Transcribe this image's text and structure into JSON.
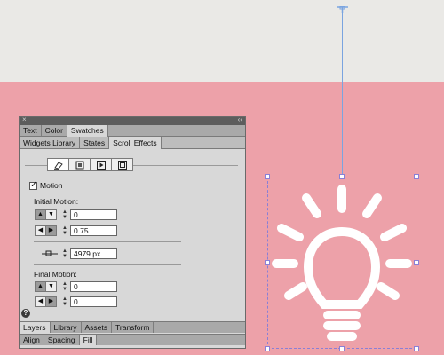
{
  "panel": {
    "close_glyph": "×",
    "collapse_glyph": "‹‹",
    "top_tabs": [
      "Text",
      "Color",
      "Swatches"
    ],
    "sub_tabs": [
      "Widgets Library",
      "States",
      "Scroll Effects"
    ],
    "mode_icons": [
      "eraser-icon",
      "layout-icon",
      "play-icon",
      "slideshow-icon"
    ],
    "motion_label": "Motion",
    "motion_checked": true,
    "initial_motion_label": "Initial Motion:",
    "initial_vertical_value": "0",
    "initial_horizontal_value": "0.75",
    "key_position_value": "4979 px",
    "final_motion_label": "Final Motion:",
    "final_vertical_value": "0",
    "final_horizontal_value": "0",
    "help_glyph": "?",
    "bottom_tabs_row1": [
      "Layers",
      "Library",
      "Assets",
      "Transform"
    ],
    "bottom_tabs_row2": [
      "Align",
      "Spacing",
      "Fill"
    ]
  },
  "colors": {
    "canvas_top": "#eae9e6",
    "canvas_pink": "#eda1a9",
    "selection": "#8a7fd6",
    "guide": "#7aa4e0",
    "bulb": "#ffffff"
  }
}
